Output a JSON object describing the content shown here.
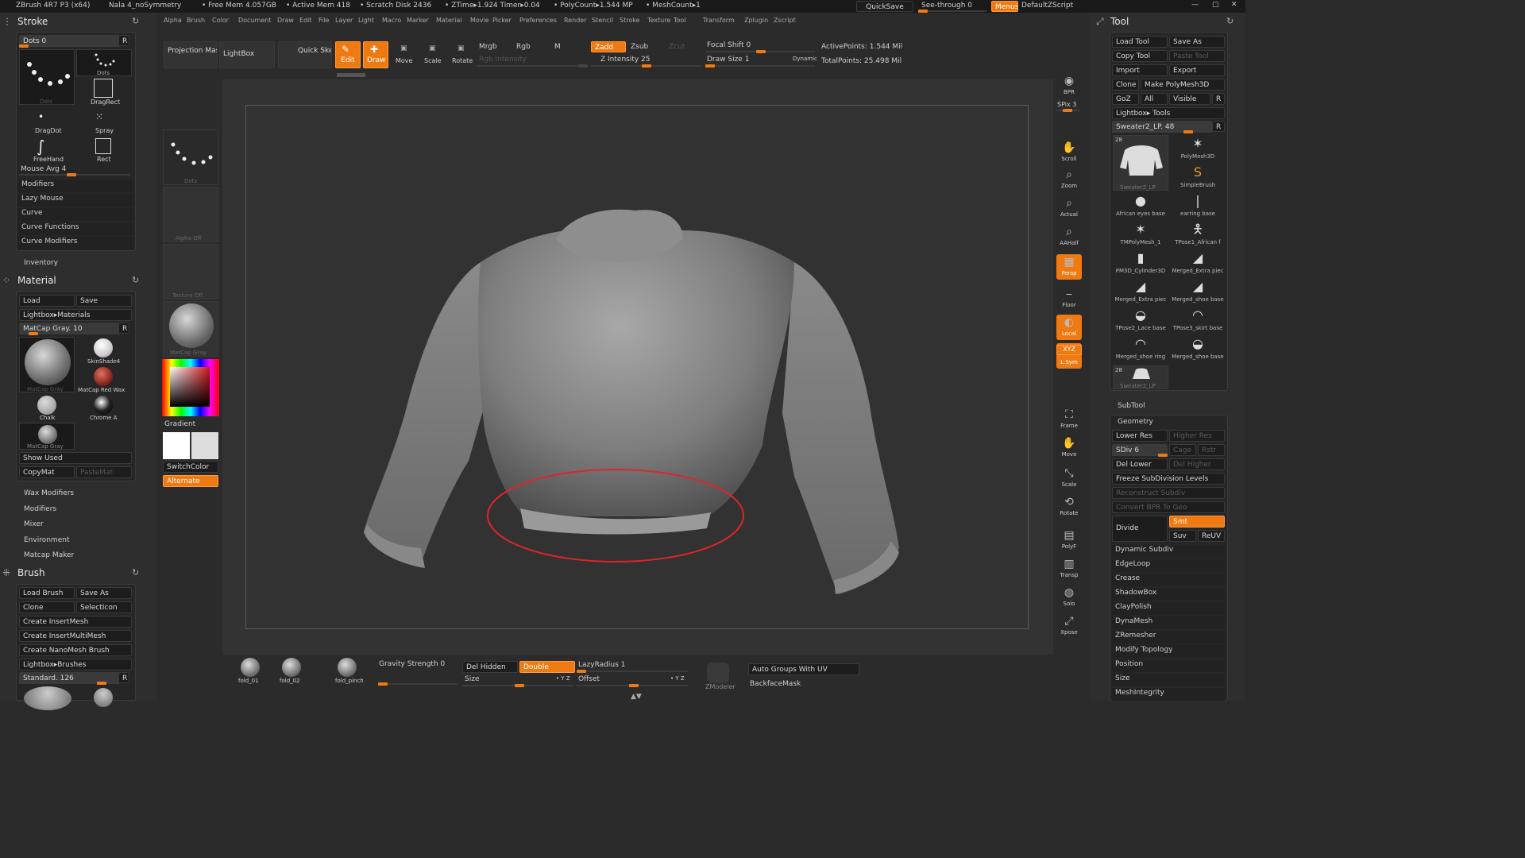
{
  "titlebar": {
    "app": "ZBrush 4R7 P3 (x64)",
    "doc": "Nala 4_noSymmetry",
    "freemem": "• Free Mem 4.057GB",
    "activemem": "• Active Mem 418",
    "scratch": "• Scratch Disk 2436",
    "ztime": "• ZTime▸1.924 Timer▸0.04",
    "poly": "• PolyCount▸1.544 MP",
    "mesh": "• MeshCount▸1",
    "quicksave": "QuickSave",
    "seethrough": "See-through 0",
    "menus": "Menus",
    "script": "DefaultZScript"
  },
  "menubar": [
    "Alpha",
    "Brush",
    "Color",
    "Document",
    "Draw",
    "Edit",
    "File",
    "Layer",
    "Light",
    "Macro",
    "Marker",
    "Material",
    "Movie",
    "Picker",
    "Preferences",
    "Render",
    "Stencil",
    "Stroke",
    "Texture",
    "Tool",
    "Transform",
    "Zplugin",
    "Zscript"
  ],
  "topshelf": {
    "projection": "Projection Master",
    "lightbox": "LightBox",
    "quicksketch": "Quick Sketch",
    "edit": "Edit",
    "draw": "Draw",
    "move": "Move",
    "scale": "Scale",
    "rotate": "Rotate",
    "mrgb": "Mrgb",
    "rgb": "Rgb",
    "m": "M",
    "rgbint": "Rgb Intensity",
    "zadd": "Zadd",
    "zsub": "Zsub",
    "zcut": "Zcut",
    "zint": "Z Intensity 25",
    "focal": "Focal Shift 0",
    "drawsize": "Draw Size 1",
    "dynamic": "Dynamic",
    "active": "ActivePoints: 1.544 Mil",
    "total": "TotalPoints: 25.498 Mil"
  },
  "stroke": {
    "title": "Stroke",
    "dots": "Dots 0",
    "r": "R",
    "items": [
      "Dots",
      "Dots",
      "DragRect",
      "DragDot",
      "Spray",
      "FreeHand",
      "Rect"
    ],
    "mouseavg": "Mouse Avg 4",
    "menu": [
      "Modifiers",
      "Lazy Mouse",
      "Curve",
      "Curve Functions",
      "Curve Modifiers"
    ],
    "inventory": "Inventory"
  },
  "material": {
    "title": "Material",
    "load": "Load",
    "save": "Save",
    "lightbox": "Lightbox▸Materials",
    "current": "MatCap Gray. 10",
    "r": "R",
    "items": [
      "MatCap Gray",
      "SkinShade4",
      "MatCap Red Wax",
      "Chalk",
      "Chrome A",
      "MatCap Gray"
    ],
    "showused": "Show Used",
    "copymat": "CopyMat",
    "pastemat": "PasteMat",
    "menu": [
      "Wax Modifiers",
      "Modifiers",
      "Mixer",
      "Environment",
      "Matcap Maker"
    ]
  },
  "brush": {
    "title": "Brush",
    "load": "Load Brush",
    "saveas": "Save As",
    "clone": "Clone",
    "selecticon": "SelectIcon",
    "insertmesh": "Create InsertMesh",
    "insertmulti": "Create InsertMultiMesh",
    "nanomesh": "Create NanoMesh Brush",
    "lightbox": "Lightbox▸Brushes",
    "current": "Standard. 126",
    "r": "R"
  },
  "leftshelf": {
    "stroke": "Dots",
    "alpha": "Alpha Off",
    "texture": "Texture Off",
    "material": "MatCap Gray",
    "gradient": "Gradient",
    "switch": "SwitchColor",
    "alternate": "Alternate"
  },
  "rightshelf": [
    "BPR",
    "SPix 3",
    "Scroll",
    "Zoom",
    "Actual",
    "AAHalf",
    "Persp",
    "Floor",
    "Local",
    "L.Sym",
    "XYZ",
    "Frame",
    "Move",
    "Scale",
    "Rotate",
    "PolyF",
    "Transp",
    "Solo",
    "Xpose"
  ],
  "tool": {
    "title": "Tool",
    "load": "Load Tool",
    "saveas": "Save As",
    "copy": "Copy Tool",
    "paste": "Paste Tool",
    "import": "Import",
    "export": "Export",
    "clone": "Clone",
    "polymesh": "Make PolyMesh3D",
    "goz": "GoZ",
    "all": "All",
    "visible": "Visible",
    "r": "R",
    "lightbox": "Lightbox▸ Tools",
    "current": "Sweater2_LP. 48",
    "count": "28",
    "items": [
      "Sweater2_LP",
      "PolyMesh3D",
      "SimpleBrush",
      "African eyes base",
      "earring base",
      "TMPolyMesh_1",
      "TPose1_African f",
      "PM3D_Cylinder3D",
      "Merged_Extra piec",
      "Merged_Extra piec",
      "Merged_shoe base",
      "TPose2_Lace base",
      "TPose3_skirt base",
      "Merged_shoe ring",
      "Merged_shoe base",
      "Sweater2_LP"
    ],
    "subtool": "SubTool",
    "geometry": "Geometry",
    "lowerres": "Lower Res",
    "higherres": "Higher Res",
    "sdiv": "SDiv 6",
    "cage": "Cage",
    "rstr": "Rstr",
    "dellower": "Del Lower",
    "delhigher": "Del Higher",
    "freeze": "Freeze SubDivision Levels",
    "reconstruct": "Reconstruct Subdiv",
    "convert": "Convert BPR To Geo",
    "divide": "Divide",
    "smt": "Smt",
    "suv": "Suv",
    "reuv": "ReUV",
    "menu": [
      "Dynamic Subdiv",
      "EdgeLoop",
      "Crease",
      "ShadowBox",
      "ClayPolish",
      "DynaMesh",
      "ZRemesher",
      "Modify Topology",
      "Position",
      "Size",
      "MeshIntegrity"
    ]
  },
  "bottom": {
    "brushes": [
      "fold_01",
      "fold_02",
      "fold_pinch"
    ],
    "gravity": "Gravity Strength 0",
    "delhidden": "Del Hidden",
    "double": "Double",
    "lazy": "LazyRadius 1",
    "size": "Size",
    "offset": "Offset",
    "xyz": "• Y Z",
    "zmodeler": "ZModeler",
    "autogroups": "Auto Groups With UV",
    "backface": "BackfaceMask"
  },
  "colors": {
    "accent": "#ef7a12",
    "annotation": "#e0242a"
  }
}
